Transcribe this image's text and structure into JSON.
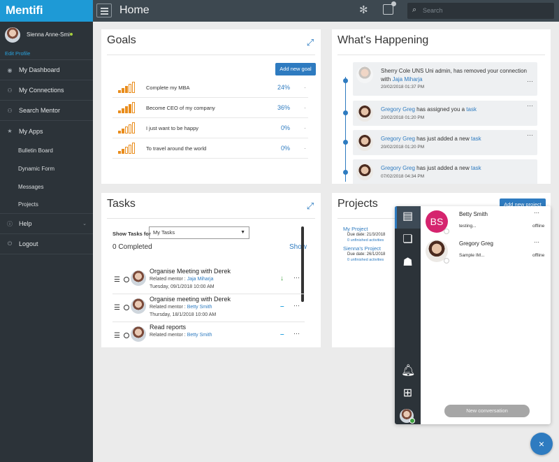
{
  "brand": "Mentifi",
  "profile": {
    "name": "Sienna Anne-Smi",
    "edit_label": "Edit Profile"
  },
  "nav": {
    "dashboard": "My Dashboard",
    "connections": "My Connections",
    "search_mentor": "Search Mentor",
    "my_apps": "My Apps",
    "bulletin": "Bulletin Board",
    "dynamic_form": "Dynamic Form",
    "messages": "Messages",
    "projects": "Projects",
    "help": "Help",
    "logout": "Logout"
  },
  "header": {
    "title": "Home",
    "search_placeholder": "Search"
  },
  "goals": {
    "title": "Goals",
    "add_label": "Add new goal",
    "items": [
      {
        "name": "Complete my MBA",
        "percent": "24%",
        "fill": 0.24
      },
      {
        "name": "Become CEO of my company",
        "percent": "36%",
        "fill": 0.36
      },
      {
        "name": "I just want to be happy",
        "percent": "0%",
        "fill": 0
      },
      {
        "name": "To travel around the world",
        "percent": "0%",
        "fill": 0
      }
    ]
  },
  "happening": {
    "title": "What's Happening",
    "events": [
      {
        "pre": "Sherry Cole UNS Uni admin, has removed your connection with ",
        "link": "Jaja Miharja",
        "post": "",
        "time": "20/02/2018 01:37 PM"
      },
      {
        "pre": "",
        "link": "Gregory Greg",
        "post": " has assigned you a ",
        "link2": "task",
        "time": "20/02/2018 01:20 PM"
      },
      {
        "pre": "",
        "link": "Gregory Greg",
        "post": " has just added a new ",
        "link2": "task",
        "time": "20/02/2018 01:20 PM"
      },
      {
        "pre": "",
        "link": "Gregory Greg",
        "post": " has just added a new ",
        "link2": "task",
        "time": "07/02/2018 04:34 PM"
      }
    ]
  },
  "tasks": {
    "title": "Tasks",
    "show_label": "Show Tasks for",
    "filter_value": "My Tasks",
    "completed": "0 Completed",
    "show_link": "Show",
    "items": [
      {
        "title": "Organise Meeting with Derek",
        "mentor_label": "Related mentor : ",
        "mentor": "Jaja Miharja",
        "date": "Tuesday, 09/1/2018 10:00 AM",
        "status": "↓",
        "status_color": "#3ca03c"
      },
      {
        "title": "Organise meeting with Derek",
        "mentor_label": "Related mentor : ",
        "mentor": "Betty Smith",
        "date": "Thursday, 18/1/2018 10:00 AM",
        "status": "–",
        "status_color": "#29a3df"
      },
      {
        "title": "Read reports",
        "mentor_label": "Related mentor : ",
        "mentor": "Betty Smith",
        "date": "",
        "status": "–",
        "status_color": "#29a3df"
      }
    ]
  },
  "projects": {
    "title": "Projects",
    "add_label": "Add new project",
    "items": [
      {
        "name": "My Project",
        "due": "Due date: 21/3/2018",
        "activities": "0 unfinished activities"
      },
      {
        "name": "Sienna's Project",
        "due": "Due date: 26/1/2018",
        "activities": "0 unfinished activities"
      }
    ]
  },
  "chat": {
    "conversations": [
      {
        "initials": "BS",
        "name": "Betty Smith",
        "message": "testing...",
        "state": "offline"
      },
      {
        "initials": "",
        "name": "Gregory Greg",
        "message": "Sample IM...",
        "state": "offline"
      }
    ],
    "new_conversation": "New conversation",
    "close_label": "×"
  },
  "colors": {
    "brand": "#1e9ad6",
    "accent": "#2e7bc0",
    "sidebar": "#2c3339",
    "topbar": "#3d4850"
  }
}
